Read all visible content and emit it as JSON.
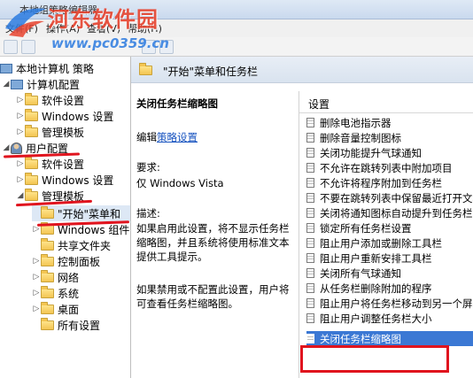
{
  "window": {
    "title": "本地组策略编辑器"
  },
  "menu": {
    "items": [
      "文件(F)",
      "操作(A)",
      "查看(V)",
      "帮助(H)"
    ]
  },
  "watermark": {
    "text": "河东软件园",
    "url": "www.pc0359.cn"
  },
  "tree": {
    "root": "本地计算机 策略",
    "computer_config": "计算机配置",
    "cc_software": "软件设置",
    "cc_windows": "Windows 设置",
    "cc_admin": "管理模板",
    "user_config": "用户配置",
    "uc_software": "软件设置",
    "uc_windows": "Windows 设置",
    "uc_admin": "管理模板",
    "start_taskbar": "\"开始\"菜单和",
    "windows_components": "Windows 组件",
    "shared_folders": "共享文件夹",
    "control_panel": "控制面板",
    "network": "网络",
    "system": "系统",
    "desktop": "桌面",
    "all_settings": "所有设置"
  },
  "middle": {
    "header": "\"开始\"菜单和任务栏",
    "policy_title": "关闭任务栏缩略图",
    "edit_prefix": "编辑",
    "edit_link": "策略设置",
    "requirements_label": "要求:",
    "requirements": "仅 Windows Vista",
    "description_label": "描述:",
    "description": "如果启用此设置，将不显示任务栏缩略图，并且系统将使用标准文本提供工具提示。",
    "description2": "如果禁用或不配置此设置，用户将可查看任务栏缩略图。"
  },
  "settings": {
    "header": "设置",
    "items": [
      "删除电池指示器",
      "删除音量控制图标",
      "关闭功能提升气球通知",
      "不允许在跳转列表中附加项目",
      "不允许将程序附加到任务栏",
      "不要在跳转列表中保留最近打开文档的",
      "关闭将通知图标自动提升到任务栏",
      "锁定所有任务栏设置",
      "阻止用户添加或删除工具栏",
      "阻止用户重新安排工具栏",
      "关闭所有气球通知",
      "从任务栏删除附加的程序",
      "阻止用户将任务栏移动到另一个屏幕",
      "阻止用户调整任务栏大小",
      "关闭任务栏缩略图"
    ]
  }
}
